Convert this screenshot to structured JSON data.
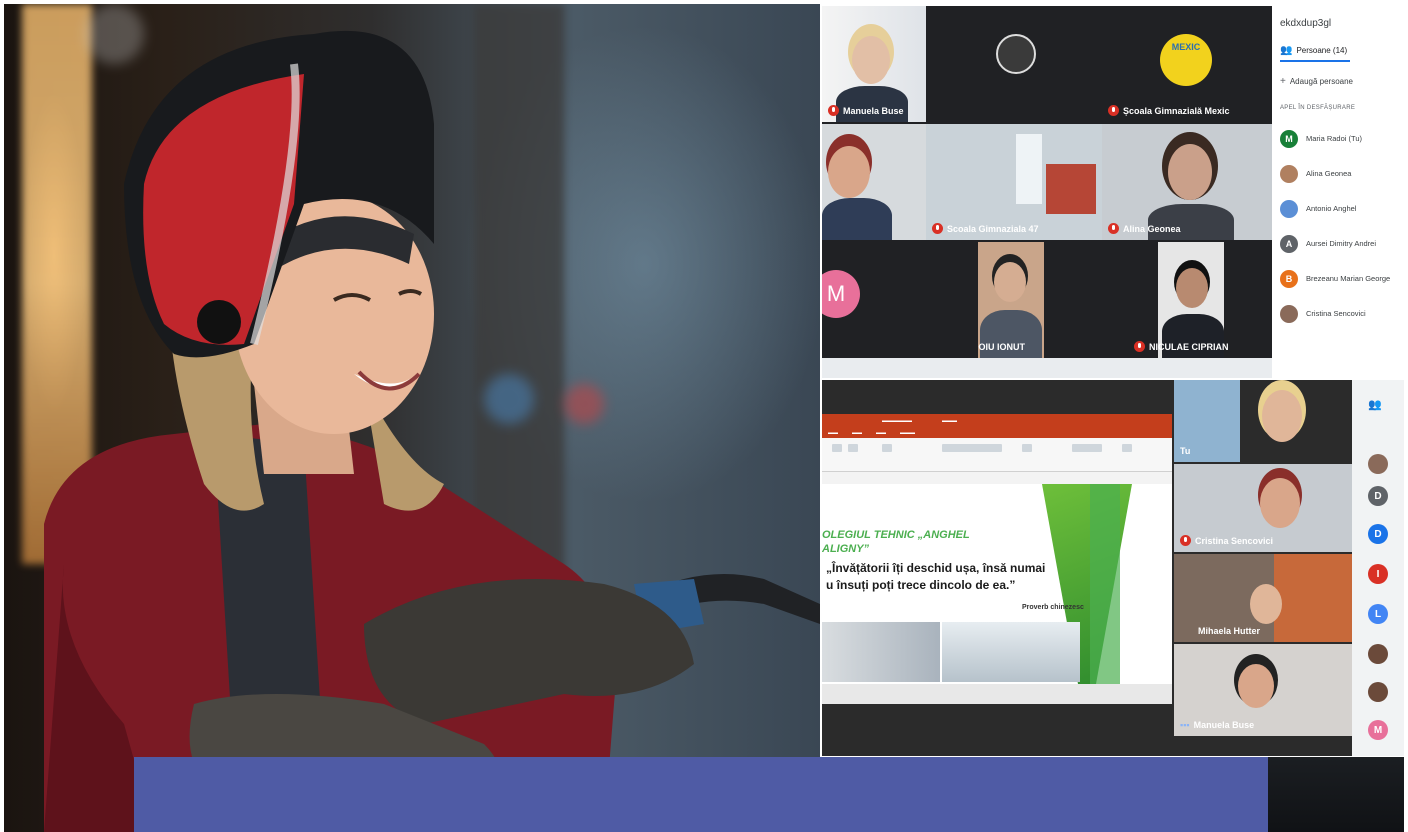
{
  "meeting": {
    "code": "ekdxdup3gl",
    "people_tab": "Persoane (14)",
    "add_people": "Adaugă persoane",
    "section_label": "APEL ÎN DESFĂȘURARE",
    "tiles": [
      {
        "name": "Manuela Buse"
      },
      {
        "name": "Școala Gimnazială Mexic"
      },
      {
        "name": "Scoala Gimnaziala 47"
      },
      {
        "name": "Alina Geonea"
      },
      {
        "name": "PURDOIU IONUT"
      },
      {
        "name": "NICULAE CIPRIAN"
      }
    ],
    "mexic_logo_text": "MEXIC",
    "letter_avatar": "M",
    "participants": [
      {
        "name": "Maria Radoi (Tu)",
        "initial": "M",
        "color": "#188038"
      },
      {
        "name": "Alina Geonea",
        "initial": "",
        "color": "#b08060"
      },
      {
        "name": "Antonio Anghel",
        "initial": "",
        "color": "#5b8fd6"
      },
      {
        "name": "Aursei Dimitry Andrei",
        "initial": "A",
        "color": "#5f6368"
      },
      {
        "name": "Brezeanu Marian George",
        "initial": "B",
        "color": "#e8711a"
      },
      {
        "name": "Cristina Sencovici",
        "initial": "",
        "color": "#8a6a5a"
      }
    ]
  },
  "presentation": {
    "title_line1": "OLEGIUL TEHNIC „ANGHEL",
    "title_line2": "ALIGNY”",
    "quote_line1": "„Învățătorii îți deschid ușa, însă numai",
    "quote_line2": "u însuți poți trece dincolo de ea.”",
    "source": "Proverb chinezesc",
    "thumbnails": [
      {
        "name": "Tu"
      },
      {
        "name": ""
      },
      {
        "name": "Cristina Sencovici"
      },
      {
        "name": "Mihaela Hutter"
      },
      {
        "name": "Manuela Buse"
      }
    ],
    "rail_avatars": [
      {
        "initial": "D",
        "color": "#5f6368"
      },
      {
        "initial": "D",
        "color": "#1a73e8"
      },
      {
        "initial": "I",
        "color": "#d93025"
      },
      {
        "initial": "L",
        "color": "#4285f4"
      },
      {
        "initial": "M",
        "color": "#e8709a"
      }
    ]
  },
  "colors": {
    "banner": "#4f5ba5",
    "meet_bg": "#202124",
    "mute_red": "#d93025",
    "ppt_red": "#c43e1c",
    "slide_green": "#4caf50"
  }
}
